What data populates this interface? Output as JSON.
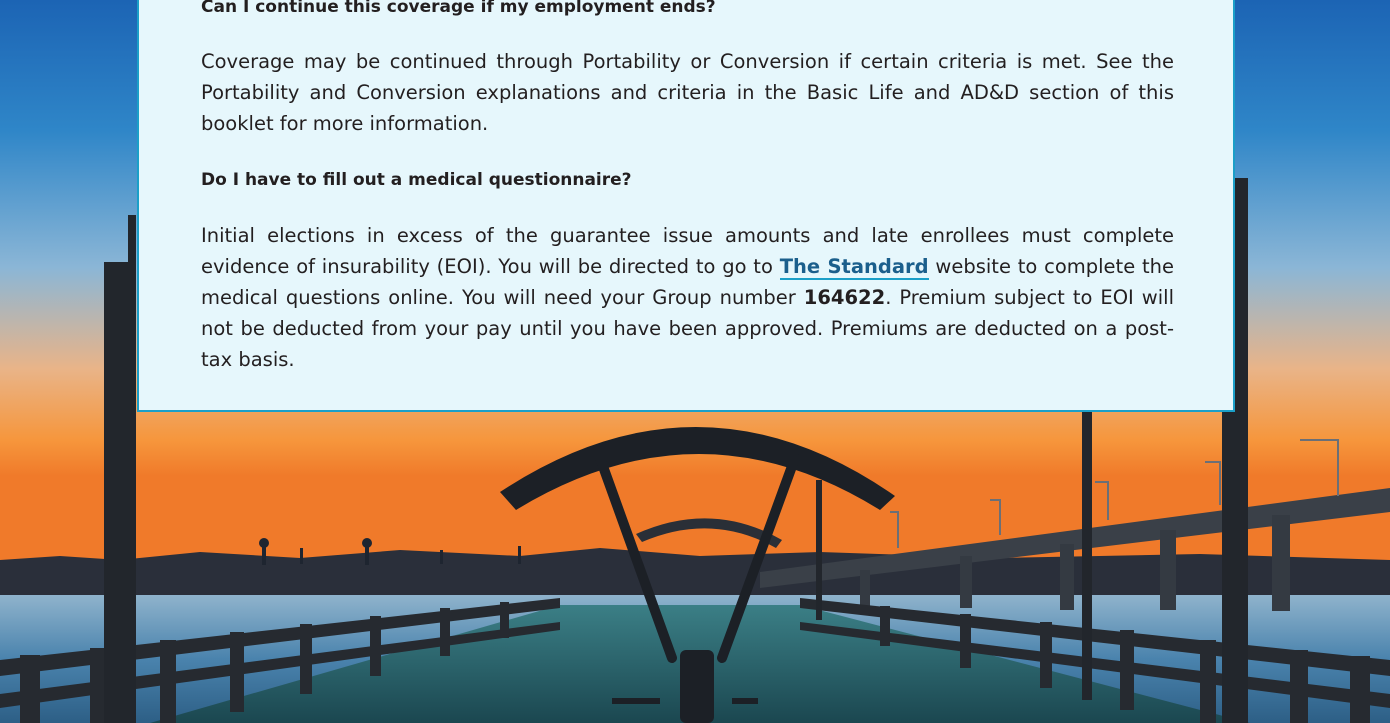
{
  "faq": [
    {
      "question": "Can I continue this coverage if my employment ends?",
      "answer": "Coverage may be continued through Portability or Conversion if certain criteria is met. See the Portability and Conversion explanations and criteria in the Basic Life and AD&D section of this booklet for more information."
    },
    {
      "question": "Do I have to fill out a medical questionnaire?",
      "answer_part1": "Initial elections in excess of the guarantee issue amounts and late enrollees must complete evidence of insurability (EOI). You will be directed to go to ",
      "answer_link": "The Standard",
      "answer_part2": " website to complete the medical questions online. You will need your Group number ",
      "group_number": "164622",
      "answer_part3": ". Premium subject to EOI will not be deducted from your pay until you have been approved. Premiums are deducted on a post-tax basis."
    }
  ],
  "background": {
    "subject": "pier-at-sunset-photo",
    "sky_top": "#1c64b4",
    "horizon": "#f39a40",
    "water": "#3f78a2"
  },
  "colors": {
    "panel_fill": "#e6f7fc",
    "panel_border": "#1b9fc8",
    "text": "#231f20",
    "link": "#1b5f8c"
  }
}
